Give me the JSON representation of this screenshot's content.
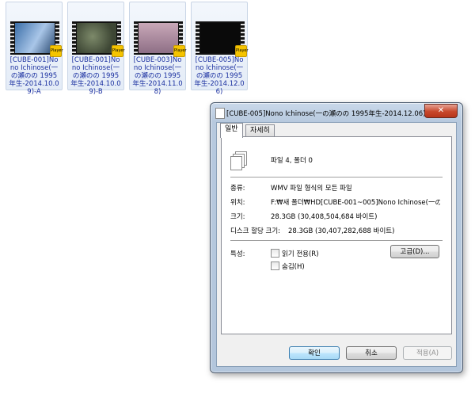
{
  "files": [
    {
      "label": "[CUBE-001]Nono Ichinose(一の瀬のの 1995年生-2014.10.09)-A",
      "badge": "Player"
    },
    {
      "label": "[CUBE-001]Nono Ichinose(一の瀬のの 1995年生-2014.10.09)-B",
      "badge": "Player"
    },
    {
      "label": "[CUBE-003]Nono Ichinose(一の瀬のの 1995年生-2014.11.08)",
      "badge": "Player"
    },
    {
      "label": "[CUBE-005]Nono Ichinose(一の瀬のの 1995年生-2014.12.06)",
      "badge": "Player"
    }
  ],
  "dialog": {
    "title": "[CUBE-005]Nono Ichinose(一の瀬のの 1995年生-2014.12.06), ... ...",
    "close": "✕",
    "tabs": [
      "일반",
      "자세히"
    ],
    "summary": "파일 4, 폴더 0",
    "rows": [
      {
        "label": "종류:",
        "value": "WMV 파일 형식의 모든 파일"
      },
      {
        "label": "위치:",
        "value": "F:₩새 폴더₩HD[CUBE-001~005]Nono Ichinose(一の"
      },
      {
        "label": "크기:",
        "value": "28.3GB (30,408,504,684 바이트)"
      },
      {
        "label": "디스크 할당 크기:",
        "value": "28.3GB (30,407,282,688 바이트)"
      }
    ],
    "attributes_label": "특성:",
    "readonly_label": "읽기 전용(R)",
    "hidden_label": "숨김(H)",
    "advanced_button": "고급(D)...",
    "ok_button": "확인",
    "cancel_button": "취소",
    "apply_button": "적용(A)"
  }
}
